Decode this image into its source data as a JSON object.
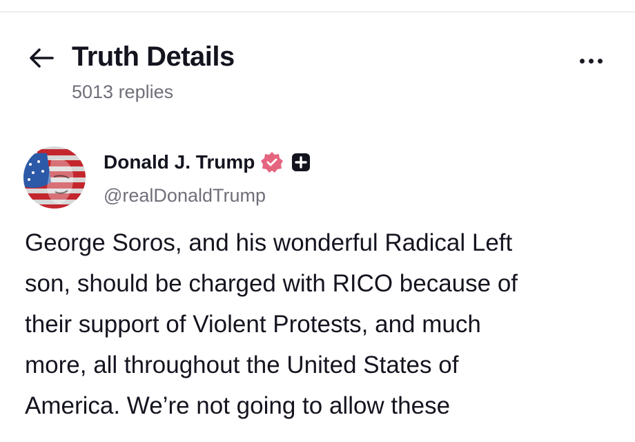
{
  "header": {
    "title": "Truth Details",
    "reply_count": "5013 replies",
    "back_icon": "arrow-left-icon",
    "more_icon": "more-horizontal-icon"
  },
  "post": {
    "author": {
      "display_name": "Donald J. Trump",
      "handle": "@realDonaldTrump",
      "verified_badge_icon": "verified-badge-icon",
      "plus_badge_icon": "plus-badge-icon",
      "verified_color": "#e5657f"
    },
    "text": "George Soros, and his wonderful Radical Left\nson, should be charged with RICO because of\ntheir support of Violent Protests, and much\nmore, all throughout the United States of\nAmerica. We’re not going to allow these"
  },
  "colors": {
    "text_primary": "#14141f",
    "text_secondary": "#6f6f7a",
    "divider": "#ececec",
    "background": "#ffffff"
  }
}
